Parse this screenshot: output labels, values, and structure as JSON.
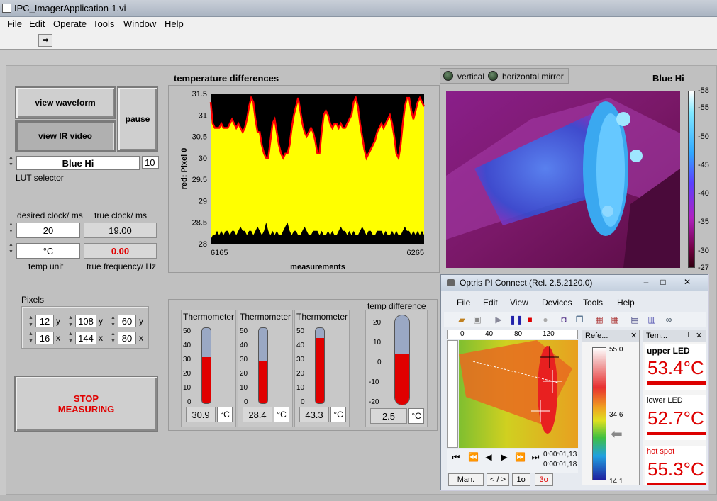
{
  "window": {
    "title": "IPC_ImagerApplication-1.vi"
  },
  "menu": [
    "File",
    "Edit",
    "Operate",
    "Tools",
    "Window",
    "Help"
  ],
  "buttons": {
    "view_waveform": "view waveform",
    "view_ir_video": "view IR video",
    "pause": "pause",
    "stop_line1": "STOP",
    "stop_line2": "MEASURING"
  },
  "lut": {
    "value": "Blue Hi",
    "index": "10",
    "label": "LUT selector"
  },
  "clock": {
    "desired_label": "desired clock/ ms",
    "true_label": "true clock/ ms",
    "desired_value": "20",
    "true_value": "19.00",
    "unit_value": "°C",
    "freq_value": "0.00",
    "unit_label": "temp unit",
    "freq_label": "true frequency/ Hz"
  },
  "pixels": {
    "label": "Pixels",
    "p1": {
      "y": "12",
      "x": "16"
    },
    "p2": {
      "y": "108",
      "x": "144"
    },
    "p3": {
      "y": "60",
      "x": "80"
    },
    "ylbl": "y",
    "xlbl": "x"
  },
  "chart_data": {
    "type": "area",
    "title": "temperature differences",
    "xlabel": "measurements",
    "ylabel": "red: Pixel 0",
    "xlim": [
      6165,
      6265
    ],
    "ylim": [
      28,
      31.5
    ],
    "yticks": [
      31.5,
      31,
      30.5,
      30,
      29.5,
      29,
      28.5,
      28
    ],
    "xticks": [
      6165,
      6265
    ],
    "upper": [
      31.3,
      30.8,
      30.7,
      30.7,
      30.7,
      30.8,
      30.7,
      30.7,
      30.7,
      30.8,
      30.9,
      30.8,
      30.7,
      30.8,
      30.7,
      30.6,
      30.7,
      30.9,
      31.2,
      31.4,
      31.3,
      30.9,
      30.6,
      30.6,
      30.3,
      30.1,
      30.0,
      30.0,
      30.4,
      30.8,
      30.9,
      30.6,
      30.3,
      30.1,
      30.0,
      30.1,
      30.1,
      30.3,
      30.7,
      31.0,
      31.2,
      31.4,
      31.1,
      30.8,
      30.6,
      30.5,
      30.6,
      30.7,
      30.6,
      30.4,
      30.1,
      30.1,
      30.6,
      31.0,
      31.1,
      31.0,
      30.8,
      30.7,
      30.8,
      30.8,
      30.7,
      30.8,
      30.7,
      30.7,
      30.8,
      30.9,
      31.0,
      31.3,
      31.4,
      31.2,
      30.8,
      30.5,
      30.2,
      30.0,
      30.1,
      30.2,
      30.3,
      30.4,
      30.6,
      30.7,
      30.8,
      30.7,
      30.8,
      30.9,
      31.0,
      30.8,
      30.5,
      30.1,
      30.0,
      30.3,
      30.8,
      31.2,
      31.4,
      31.4,
      31.1,
      30.9,
      31.1,
      31.3,
      31.4,
      31.3,
      31.2
    ],
    "lower": [
      28.1,
      28.2,
      28.2,
      28.3,
      28.2,
      28.3,
      28.2,
      28.3,
      28.3,
      28.2,
      28.3,
      28.3,
      28.2,
      28.3,
      28.4,
      28.3,
      28.3,
      28.2,
      28.3,
      28.3,
      28.2,
      28.3,
      28.4,
      28.3,
      28.2,
      28.3,
      28.5,
      28.3,
      28.2,
      28.3,
      28.2,
      28.3,
      28.2,
      28.2,
      28.3,
      28.4,
      28.5,
      28.3,
      28.2,
      28.3,
      28.3,
      28.2,
      28.2,
      28.3,
      28.4,
      28.3,
      28.2,
      28.2,
      28.3,
      28.3,
      28.3,
      28.2,
      28.3,
      28.2,
      28.2,
      28.3,
      28.2,
      28.3,
      28.2,
      28.2,
      28.3,
      28.4,
      28.3,
      28.3,
      28.2,
      28.3,
      28.2,
      28.3,
      28.2,
      28.2,
      28.3,
      28.4,
      28.3,
      28.2,
      28.3,
      28.3,
      28.2,
      28.2,
      28.3,
      28.3,
      28.3,
      28.2,
      28.3,
      28.2,
      28.2,
      28.3,
      28.2,
      28.3,
      28.2,
      28.2,
      28.3,
      28.4,
      28.3,
      28.3,
      28.2,
      28.3,
      28.2,
      28.3,
      28.2,
      28.3,
      28.2
    ],
    "colors": {
      "fill": "#ffff00",
      "line": "#ff0000",
      "background": "#000000"
    }
  },
  "ir": {
    "vertical": "vertical",
    "horizontal": "horizontal mirror",
    "title": "Blue Hi",
    "scale": [
      "58",
      "55",
      "50",
      "45",
      "40",
      "35",
      "30",
      "27"
    ]
  },
  "thermometers": {
    "label": "Thermometer",
    "scale": [
      "50",
      "40",
      "30",
      "20",
      "10",
      "0"
    ],
    "unit": "°C",
    "items": [
      {
        "value": "30.9",
        "level": 0.618
      },
      {
        "value": "28.4",
        "level": 0.568
      },
      {
        "value": "43.3",
        "level": 0.866
      }
    ]
  },
  "tempdiff": {
    "label": "temp difference",
    "scale": [
      "20",
      "10",
      "0",
      "-10",
      "-20"
    ],
    "value": "2.5",
    "unit": "°C",
    "level": 0.5625
  },
  "optris": {
    "title": "Optris PI Connect (Rel. 2.5.2120.0)",
    "menu": [
      "File",
      "Edit",
      "View",
      "Devices",
      "Tools",
      "Help"
    ],
    "ruler": [
      "0",
      "40",
      "80",
      "120"
    ],
    "time1": "0:00:01,13",
    "time2": "0:00:01,18",
    "buttons": [
      "Man.",
      "< / >",
      "1σ",
      "3σ"
    ],
    "ref_title": "Refe...",
    "ref_max": "55.0",
    "ref_mid": "34.6",
    "ref_min": "14.1",
    "temp_title": "Tem...",
    "readings": [
      {
        "name": "upper LED",
        "value": "53.4°C"
      },
      {
        "name": "lower LED",
        "value": "52.7°C"
      },
      {
        "name": "hot spot",
        "value": "55.3°C"
      }
    ]
  }
}
